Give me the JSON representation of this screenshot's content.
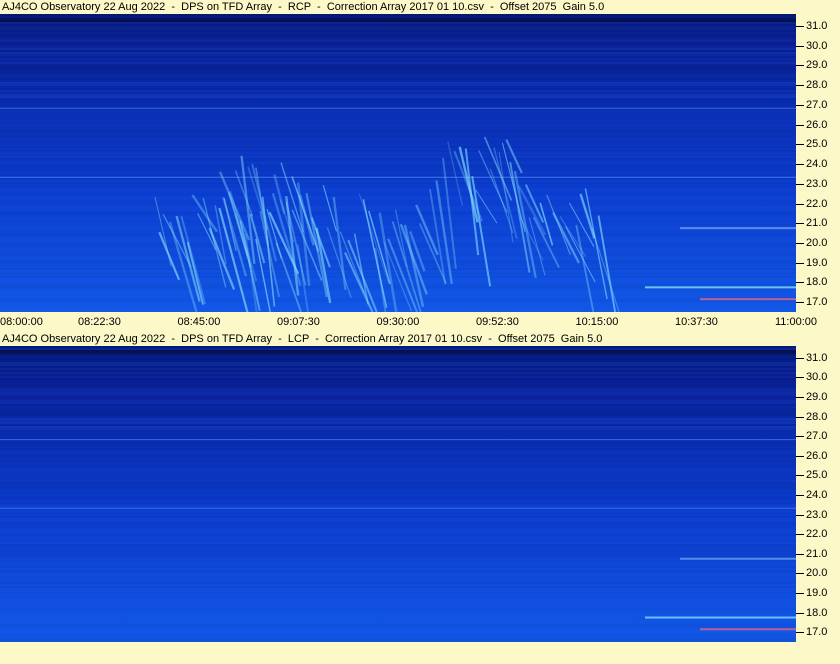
{
  "chart_data": [
    {
      "type": "heatmap",
      "title": "AJ4CO Observatory 22 Aug 2022  -  DPS on TFD Array  -  RCP  -  Correction Array 2017 01 10.csv  -  Offset 2075  Gain 5.0",
      "polarization": "RCP",
      "y_axis": {
        "ticks": [
          "31.0",
          "30.0",
          "29.0",
          "28.0",
          "27.0",
          "26.0",
          "25.0",
          "24.0",
          "23.0",
          "22.0",
          "21.0",
          "20.0",
          "19.0",
          "18.0",
          "17.0"
        ],
        "ylim": [
          16.5,
          31.6
        ]
      },
      "x_axis": {
        "ticks": [
          "08:00:00",
          "08:22:30",
          "08:45:00",
          "09:07:30",
          "09:30:00",
          "09:52:30",
          "10:15:00",
          "10:37:30",
          "11:00:00"
        ],
        "xlim": [
          "08:00:00",
          "11:00:00"
        ]
      },
      "colors": {
        "background": "#0b2fc4",
        "burst": "#7fd8ff"
      },
      "burst_activity": true
    },
    {
      "type": "heatmap",
      "title": "AJ4CO Observatory 22 Aug 2022  -  DPS on TFD Array  -  LCP  -  Correction Array 2017 01 10.csv  -  Offset 2075  Gain 5.0",
      "polarization": "LCP",
      "y_axis": {
        "ticks": [
          "31.0",
          "30.0",
          "29.0",
          "28.0",
          "27.0",
          "26.0",
          "25.0",
          "24.0",
          "23.0",
          "22.0",
          "21.0",
          "20.0",
          "19.0",
          "18.0",
          "17.0"
        ],
        "ylim": [
          16.5,
          31.6
        ]
      },
      "colors": {
        "background": "#0b2fc4"
      },
      "burst_activity": false
    }
  ]
}
